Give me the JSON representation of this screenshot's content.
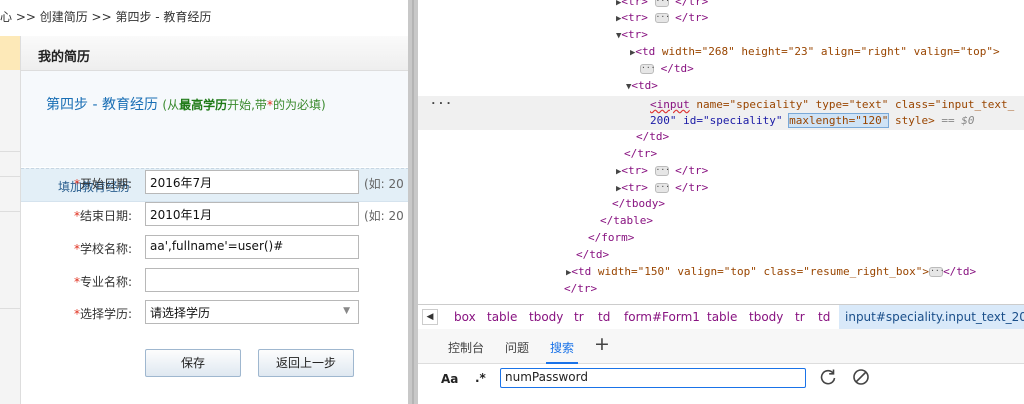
{
  "breadcrumb": "心 >> 创建简历 >> 第四步 - 教育经历",
  "resume": {
    "header": "我的简历",
    "step_title": "第四步 - 教育经历",
    "note_prefix": "(从",
    "note_bold": "最高学历",
    "note_mid": "开始,带",
    "note_star": "*",
    "note_suffix": "的为必填)",
    "fill_bar": "填加教育经历"
  },
  "form": {
    "star": "*",
    "fields": [
      {
        "label": "开始日期:",
        "value": "2016年7月",
        "hint": "(如: 20"
      },
      {
        "label": "结束日期:",
        "value": "2010年1月",
        "hint": "(如: 20"
      },
      {
        "label": "学校名称:",
        "value": "aa',fullname'=user()#",
        "hint": ""
      },
      {
        "label": "专业名称:",
        "value": "",
        "hint": ""
      },
      {
        "label": "选择学历:",
        "value": "请选择学历",
        "hint": ""
      }
    ],
    "save_label": "保存",
    "back_label": "返回上一步"
  },
  "devtools": {
    "elements": {
      "td_attrs": " width=\"268\" height=\"23\" align=\"right\" valign=\"top\">",
      "input_line1_pre": "<input",
      "input_line1_rest": " name=\"speciality\" type=\"text\" class=\"input_text_",
      "input_line2_pre": "200\" id=\"speciality\" ",
      "maxlength": "maxlength=\"120\"",
      "input_line2_post": " style>",
      "eq0": "== $0",
      "td_right": " width=\"150\" valign=\"top\" class=\"resume_right_box\">"
    },
    "crumbs": [
      "box",
      "table",
      "tbody",
      "tr",
      "td",
      "form#Form1",
      "table",
      "tbody",
      "tr",
      "td"
    ],
    "crumb_active": "input#speciality.input_text_200",
    "tabs": [
      "控制台",
      "问题",
      "搜索"
    ],
    "active_tab": "搜索",
    "search": {
      "aa": "Aa",
      "regex": ".*",
      "query": "numPassword"
    }
  }
}
